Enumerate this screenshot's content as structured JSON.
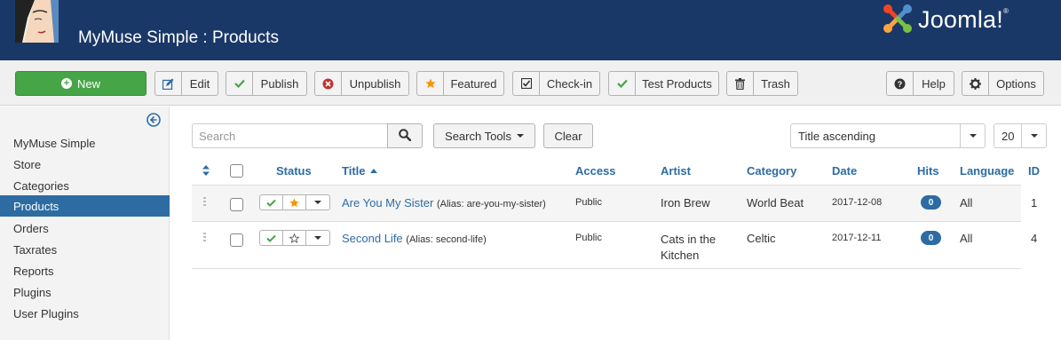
{
  "header": {
    "title": "MyMuse Simple : Products",
    "brand": "Joomla!",
    "brand_mark": "®"
  },
  "toolbar": {
    "new": "New",
    "edit": "Edit",
    "publish": "Publish",
    "unpublish": "Unpublish",
    "featured": "Featured",
    "checkin": "Check-in",
    "test_products": "Test Products",
    "trash": "Trash",
    "help": "Help",
    "options": "Options"
  },
  "sidebar": {
    "items": [
      {
        "label": "MyMuse Simple",
        "active": false
      },
      {
        "label": "Store",
        "active": false
      },
      {
        "label": "Categories",
        "active": false
      },
      {
        "label": "Products",
        "active": true
      },
      {
        "label": "Orders",
        "active": false
      },
      {
        "label": "Taxrates",
        "active": false
      },
      {
        "label": "Reports",
        "active": false
      },
      {
        "label": "Plugins",
        "active": false
      },
      {
        "label": "User Plugins",
        "active": false
      }
    ]
  },
  "filters": {
    "search_placeholder": "Search",
    "search_tools": "Search Tools",
    "clear": "Clear",
    "ordering": "Title ascending",
    "limit": "20"
  },
  "table": {
    "headers": {
      "status": "Status",
      "title": "Title",
      "access": "Access",
      "artist": "Artist",
      "category": "Category",
      "date": "Date",
      "hits": "Hits",
      "language": "Language",
      "id": "ID"
    },
    "rows": [
      {
        "title": "Are You My Sister",
        "alias": "(Alias: are-you-my-sister)",
        "access": "Public",
        "artist": "Iron Brew",
        "category": "World Beat",
        "date": "2017-12-08",
        "hits": "0",
        "language": "All",
        "id": "1",
        "featured": true
      },
      {
        "title": "Second Life",
        "alias": "(Alias: second-life)",
        "access": "Public",
        "artist": "Cats in the Kitchen",
        "category": "Celtic",
        "date": "2017-12-11",
        "hits": "0",
        "language": "All",
        "id": "4",
        "featured": false
      }
    ]
  },
  "colors": {
    "header_bg": "#1a3867",
    "accent": "#2d6ca2",
    "new_button": "#46a546",
    "published_check": "#46a546",
    "unpublish_icon": "#bd362f",
    "featured_star": "#f89406"
  }
}
